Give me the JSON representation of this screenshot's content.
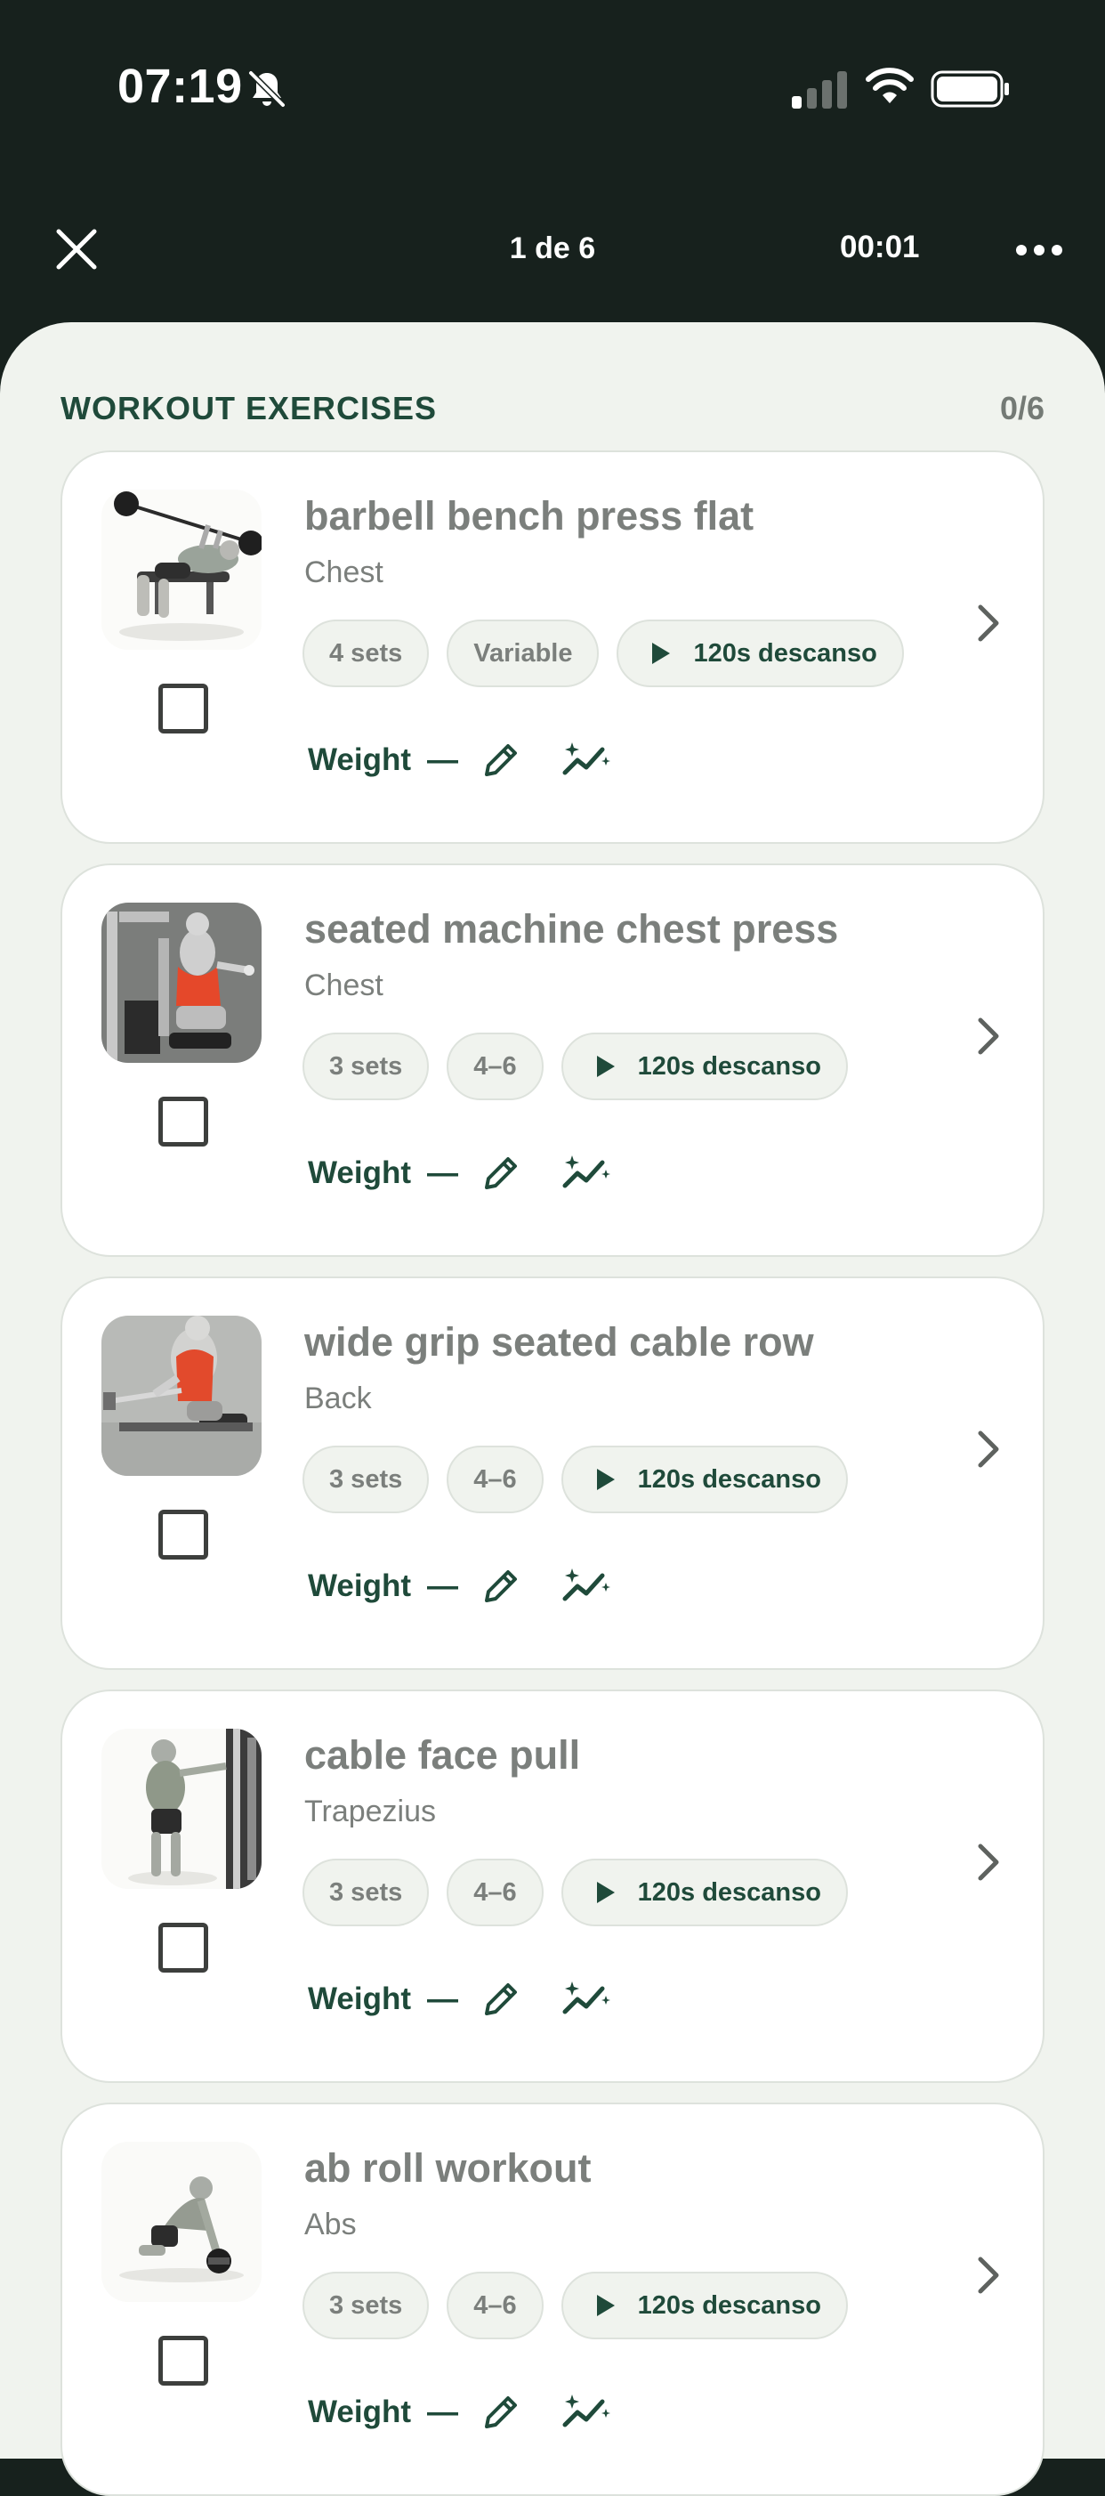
{
  "status_bar": {
    "time": "07:19"
  },
  "nav": {
    "progress": "1 de 6",
    "timer": "00:01"
  },
  "section": {
    "title": "WORKOUT EXERCISES",
    "count": "0/6"
  },
  "exercises": [
    {
      "name": "barbell bench press flat",
      "muscle": "Chest",
      "sets": "4 sets",
      "reps": "Variable",
      "rest": "120s descanso",
      "weight_label": "Weight",
      "weight_value": "—",
      "completed": false
    },
    {
      "name": "seated machine chest press",
      "muscle": "Chest",
      "sets": "3 sets",
      "reps": "4–6",
      "rest": "120s descanso",
      "weight_label": "Weight",
      "weight_value": "—",
      "completed": false
    },
    {
      "name": "wide grip seated cable row",
      "muscle": "Back",
      "sets": "3 sets",
      "reps": "4–6",
      "rest": "120s descanso",
      "weight_label": "Weight",
      "weight_value": "—",
      "completed": false
    },
    {
      "name": "cable face pull",
      "muscle": "Trapezius",
      "sets": "3 sets",
      "reps": "4–6",
      "rest": "120s descanso",
      "weight_label": "Weight",
      "weight_value": "—",
      "completed": false
    },
    {
      "name": "ab roll workout",
      "muscle": "Abs",
      "sets": "3 sets",
      "reps": "4–6",
      "rest": "120s descanso",
      "weight_label": "Weight",
      "weight_value": "—",
      "completed": false
    }
  ],
  "colors": {
    "header_bg": "#17211d",
    "sheet_bg": "#f0f3ee",
    "accent_green": "#1f4a3a",
    "muted_text": "#7b7f7c"
  },
  "icons": [
    "bell-slash-icon",
    "cellular-signal-icon",
    "wifi-icon",
    "battery-icon",
    "close-icon",
    "more-options-icon",
    "play-icon",
    "pencil-icon",
    "trend-sparkle-icon",
    "chevron-right-icon"
  ]
}
